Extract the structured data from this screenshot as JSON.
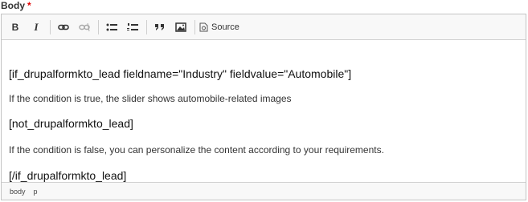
{
  "field": {
    "label": "Body",
    "required_marker": "*"
  },
  "toolbar": {
    "buttons": [
      {
        "name": "bold",
        "glyph": "B"
      },
      {
        "name": "italic",
        "glyph": "I"
      },
      {
        "name": "link",
        "icon": "link-icon"
      },
      {
        "name": "unlink",
        "icon": "unlink-icon"
      },
      {
        "name": "bulleted-list",
        "icon": "bulleted-list-icon"
      },
      {
        "name": "numbered-list",
        "icon": "numbered-list-icon"
      },
      {
        "name": "blockquote",
        "icon": "blockquote-icon"
      },
      {
        "name": "image",
        "icon": "image-icon"
      }
    ],
    "source_label": "Source"
  },
  "content": {
    "line1": "[if_drupalformkto_lead fieldname=\"Industry\" fieldvalue=\"Automobile\"]",
    "line2": "If the condition is true, the slider shows automobile-related images",
    "line3": "[not_drupalformkto_lead]",
    "line4": "If the condition is false, you can personalize the content according to your requirements.",
    "line5": "[/if_drupalformkto_lead]"
  },
  "statusbar": {
    "path": [
      "body",
      "p"
    ]
  }
}
